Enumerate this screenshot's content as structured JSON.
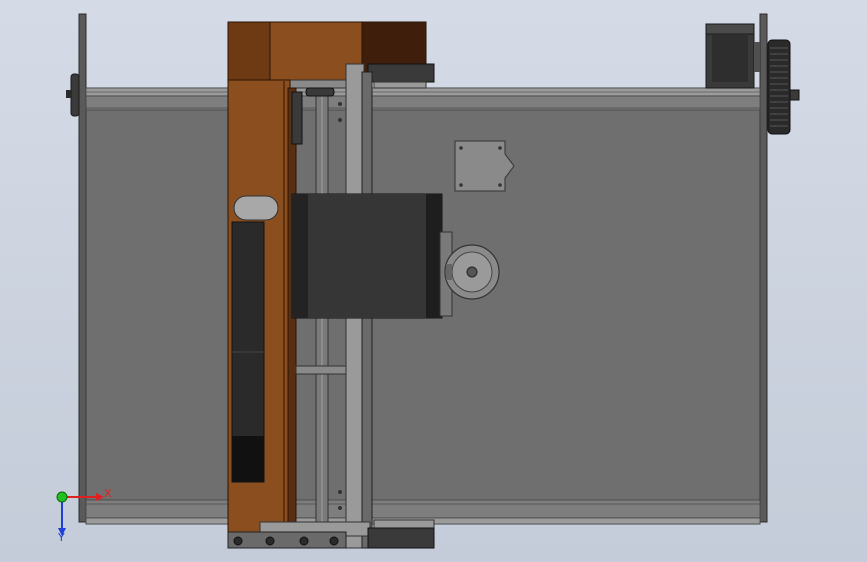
{
  "viewport": {
    "background_top": "#d5dbe6",
    "background_bottom": "#c4ccd9"
  },
  "colors": {
    "plate": "#717171",
    "frame_dark": "#4a4a4a",
    "frame_light": "#8a8a8a",
    "wood": "#8b4f1f",
    "wood_dark": "#5e3212",
    "wood_deep": "#3b1c0a",
    "motor_black": "#2d2d2d",
    "rail_gray": "#9a9a9a",
    "axis_x": "#e02020",
    "axis_y": "#1f3fd6",
    "axis_z": "#20c020"
  },
  "triad": {
    "x_label": "X",
    "y_label": "Y",
    "x_color": "#e02020",
    "y_color": "#1f3fd6",
    "origin_color": "#20c020"
  }
}
